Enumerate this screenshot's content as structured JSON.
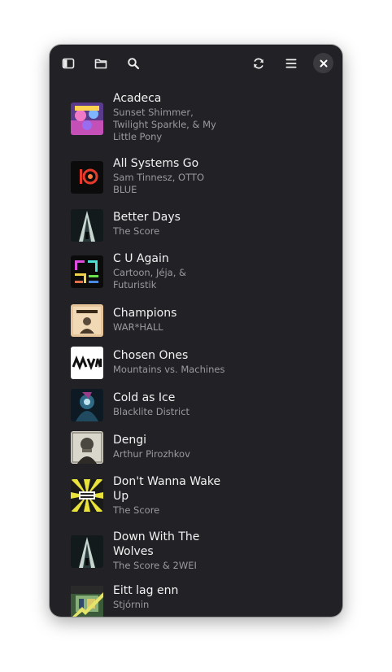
{
  "headerbar": {
    "sidebar_icon": "sidebar-toggle-icon",
    "folder_icon": "folder-icon",
    "search_icon": "search-icon",
    "refresh_icon": "refresh-icon",
    "menu_icon": "hamburger-menu-icon",
    "close_icon": "close-icon"
  },
  "colors": {
    "window_bg": "#222226",
    "title_text": "#f2f2f2",
    "subtitle_text": "#9a9a9e"
  },
  "tracks": [
    {
      "title": "Acadeca",
      "artist": "Sunset Shimmer, Twilight Sparkle, & My Little Pony"
    },
    {
      "title": "All Systems Go",
      "artist": "Sam Tinnesz, OTTO BLUE"
    },
    {
      "title": "Better Days",
      "artist": "The Score"
    },
    {
      "title": "C U Again",
      "artist": "Cartoon, Jéja, & Futuristik"
    },
    {
      "title": "Champions",
      "artist": "WAR*HALL"
    },
    {
      "title": "Chosen Ones",
      "artist": "Mountains vs. Machines"
    },
    {
      "title": "Cold as Ice",
      "artist": "Blacklite District"
    },
    {
      "title": "Dengi",
      "artist": "Arthur Pirozhkov"
    },
    {
      "title": "Don't Wanna Wake Up",
      "artist": "The Score"
    },
    {
      "title": "Down With The Wolves",
      "artist": "The Score & 2WEI"
    },
    {
      "title": "Eitt lag enn",
      "artist": "Stjórnin"
    }
  ]
}
